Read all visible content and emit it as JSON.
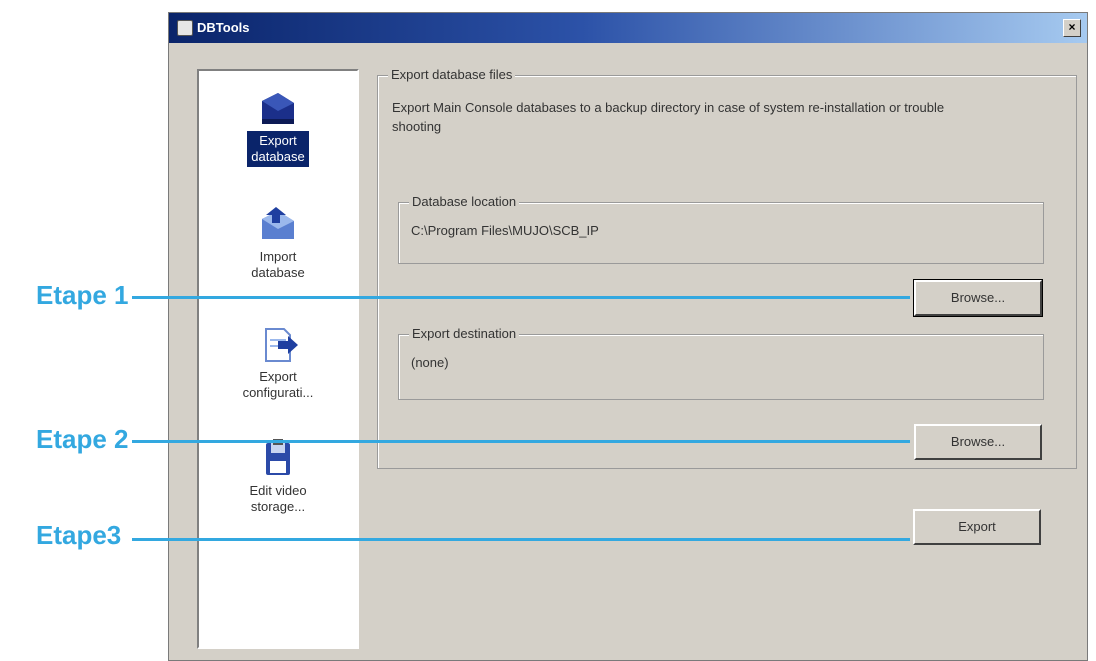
{
  "window": {
    "title": "DBTools",
    "close_glyph": "×"
  },
  "sidebar": {
    "items": [
      {
        "label_line1": "Export",
        "label_line2": "database",
        "icon": "database-export-icon",
        "active": true
      },
      {
        "label_line1": "Import",
        "label_line2": "database",
        "icon": "database-import-icon",
        "active": false
      },
      {
        "label_line1": "Export",
        "label_line2": "configurati...",
        "icon": "document-export-icon",
        "active": false
      },
      {
        "label_line1": "Edit video",
        "label_line2": "storage...",
        "icon": "floppy-disk-icon",
        "active": false
      }
    ]
  },
  "export_group": {
    "title": "Export database files",
    "description": "Export Main Console databases to a backup directory in case of system re-installation or trouble shooting"
  },
  "database_location": {
    "title": "Database location",
    "value": "C:\\Program Files\\MUJO\\SCB_IP"
  },
  "export_destination": {
    "title": "Export destination",
    "value": "(none)"
  },
  "buttons": {
    "browse_1": "Browse...",
    "browse_2": "Browse...",
    "export": "Export"
  },
  "annotations": {
    "step1": "Etape 1",
    "step2": "Etape 2",
    "step3": "Etape3"
  },
  "colors": {
    "annotation": "#33a8e0",
    "title_bar": "#0a246a",
    "dialog_bg": "#d4d0c8"
  }
}
